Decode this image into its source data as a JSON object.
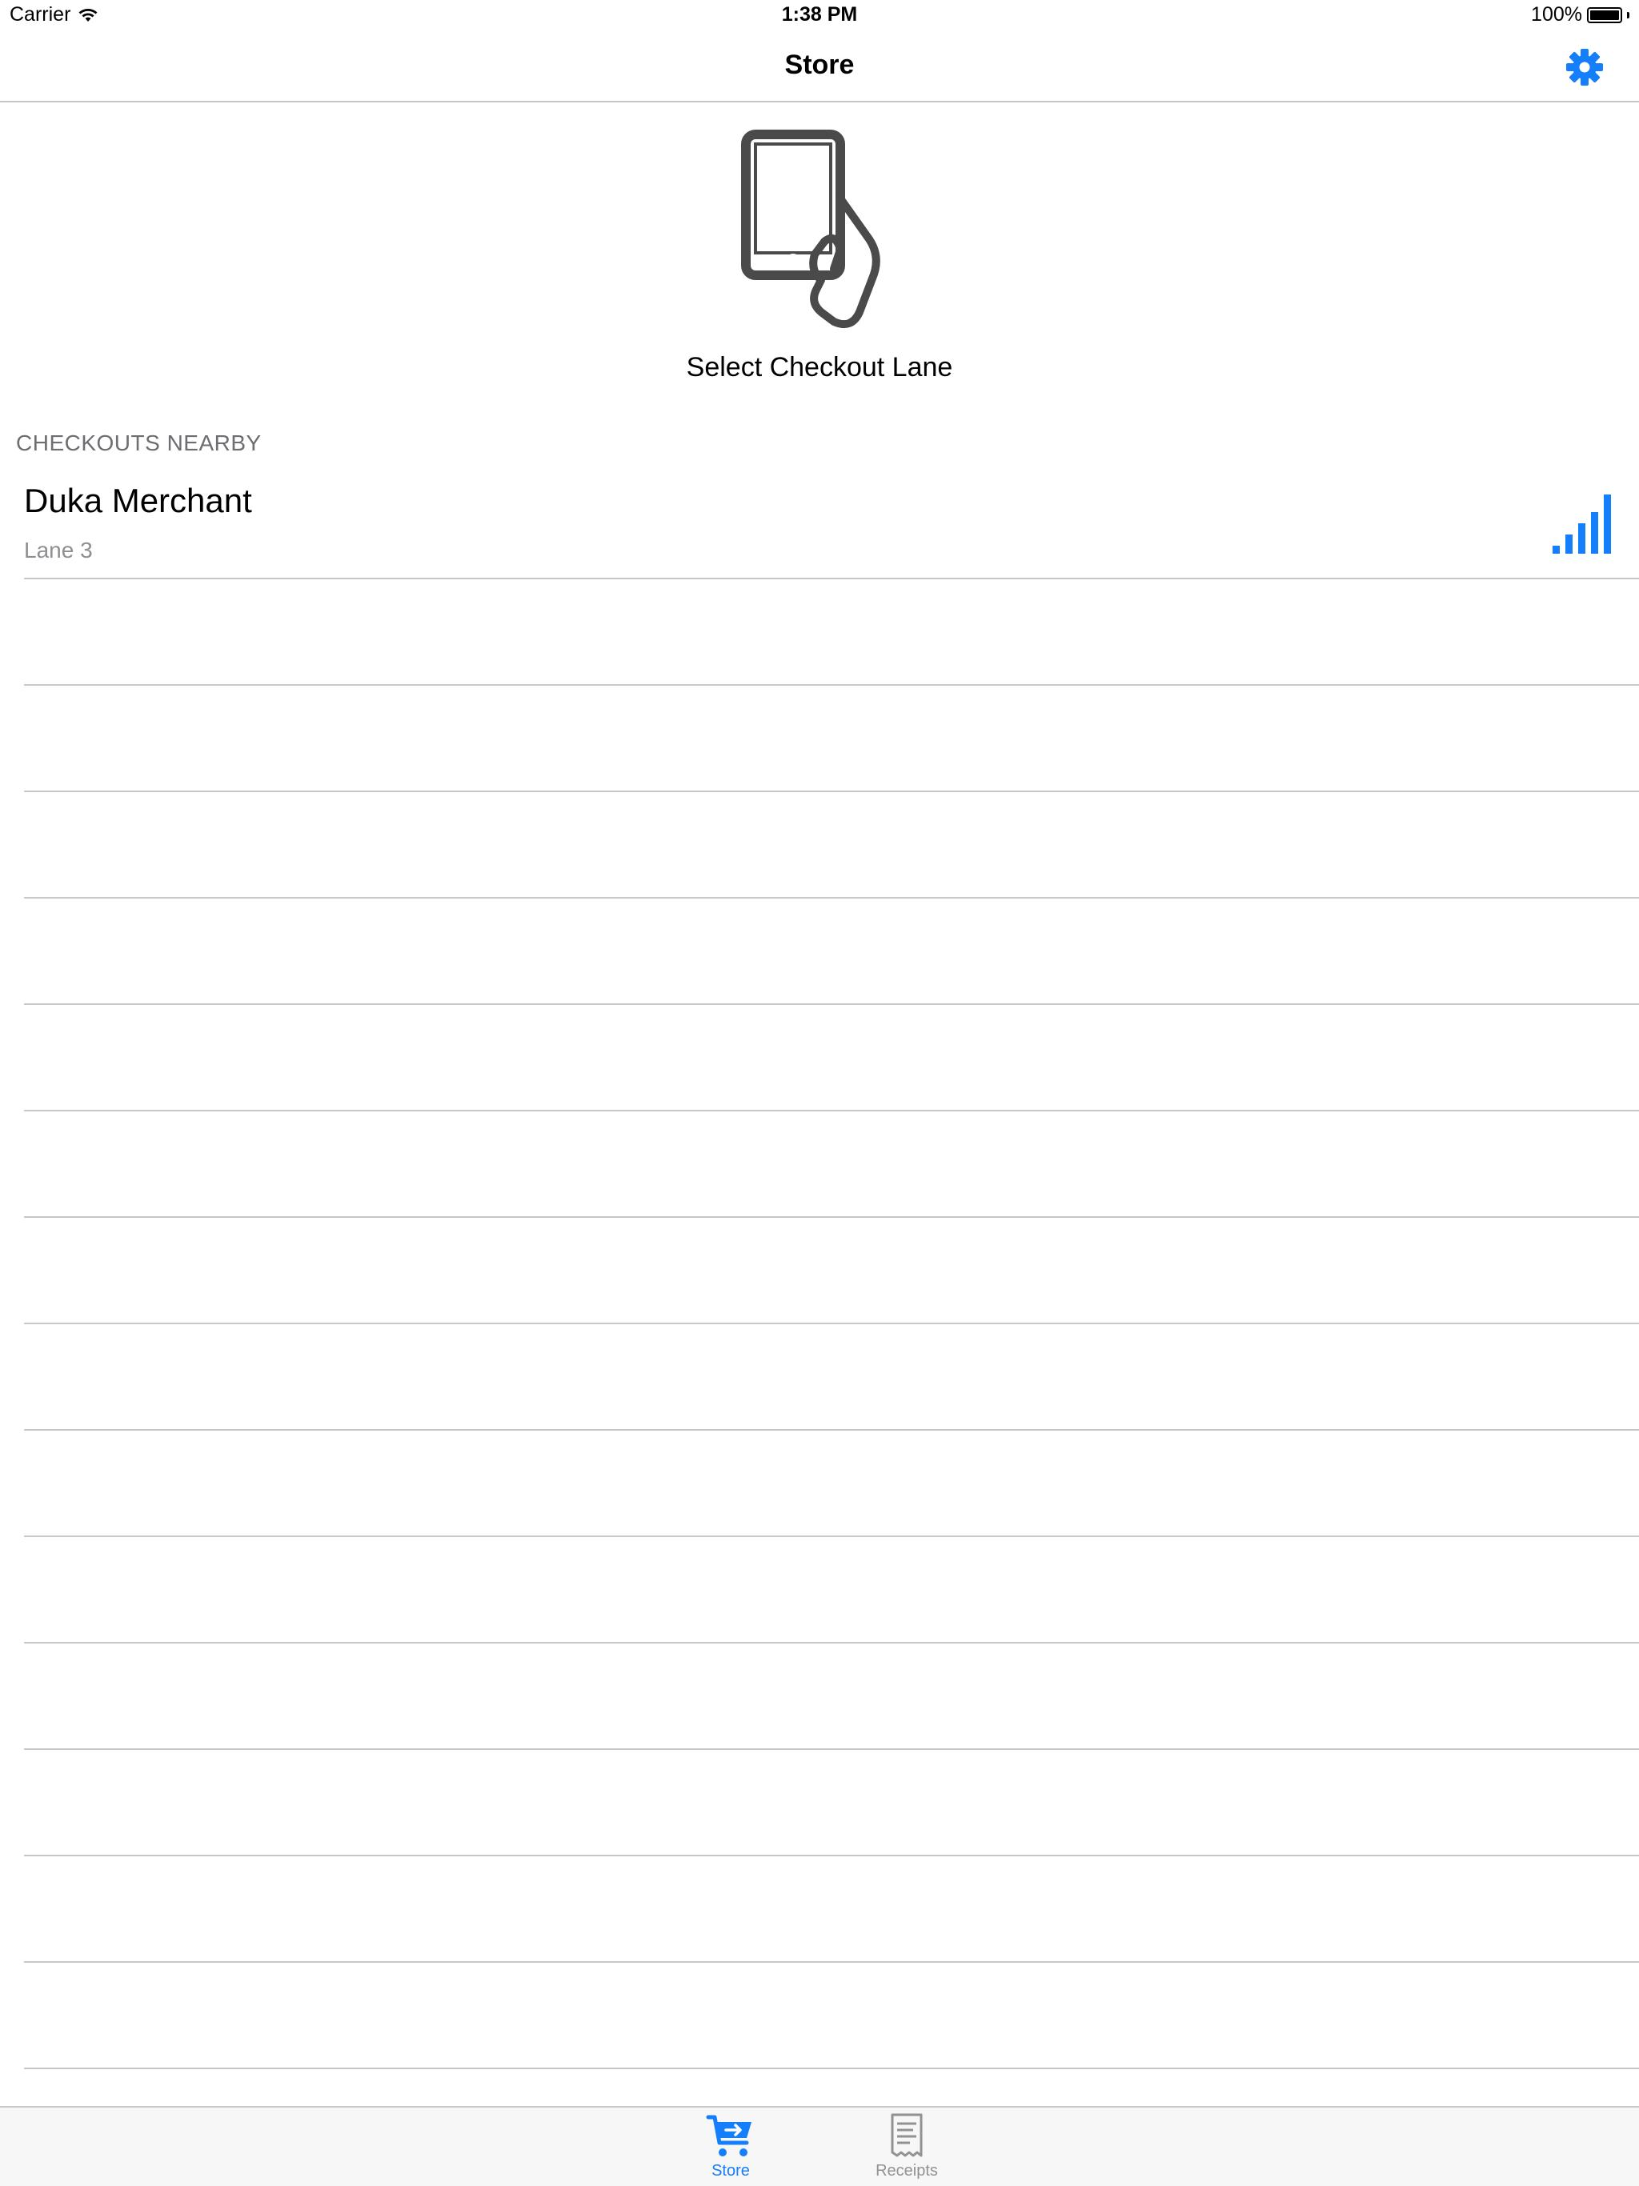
{
  "status_bar": {
    "carrier": "Carrier",
    "time": "1:38 PM",
    "battery": "100%"
  },
  "nav": {
    "title": "Store",
    "settings_icon": "gear-icon"
  },
  "hero": {
    "icon": "phone-in-hand-icon",
    "caption": "Select Checkout Lane"
  },
  "section": {
    "header": "CHECKOUTS NEARBY"
  },
  "checkouts": [
    {
      "name": "Duka Merchant",
      "lane": "Lane 3",
      "signal_icon": "signal-strength-icon",
      "signal_bars": 5
    }
  ],
  "tab_bar": {
    "tabs": [
      {
        "label": "Store",
        "icon": "cart-icon",
        "selected": true
      },
      {
        "label": "Receipts",
        "icon": "receipt-icon",
        "selected": false
      }
    ]
  },
  "colors": {
    "accent": "#147efb",
    "icon_dark": "#4a4a4a",
    "separator": "#c8c7cc",
    "secondary_text": "#8e8e93",
    "tab_inactive": "#929292"
  }
}
